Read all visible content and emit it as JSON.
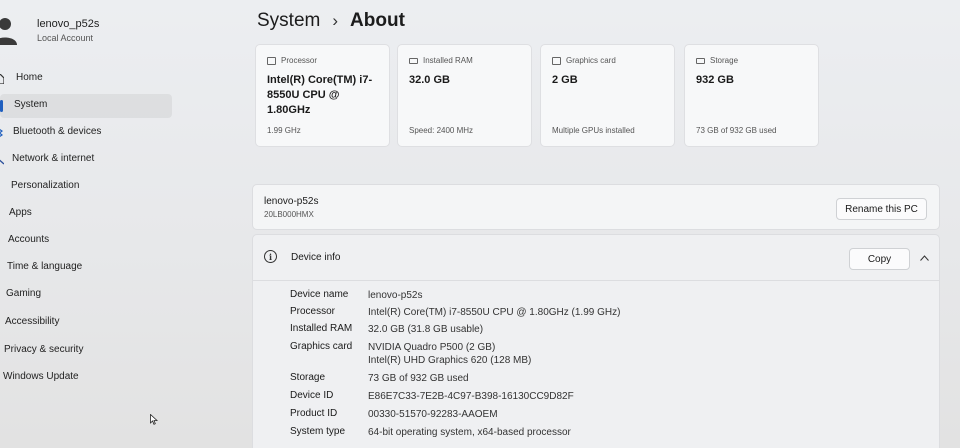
{
  "profile": {
    "name": "lenovo_p52s",
    "account_type": "Local Account"
  },
  "sidebar": {
    "items": [
      {
        "label": "Home"
      },
      {
        "label": "System",
        "active": true
      },
      {
        "label": "Bluetooth & devices"
      },
      {
        "label": "Network & internet"
      },
      {
        "label": "Personalization"
      },
      {
        "label": "Apps"
      },
      {
        "label": "Accounts"
      },
      {
        "label": "Time & language"
      },
      {
        "label": "Gaming"
      },
      {
        "label": "Accessibility"
      },
      {
        "label": "Privacy & security"
      },
      {
        "label": "Windows Update"
      }
    ]
  },
  "header": {
    "parent": "System",
    "separator": "›",
    "current": "About"
  },
  "cards": [
    {
      "title": "Processor",
      "value": "Intel(R) Core(TM) i7-8550U CPU @ 1.80GHz",
      "footer": "1.99 GHz",
      "icon": "processor-icon"
    },
    {
      "title": "Installed RAM",
      "value": "32.0 GB",
      "footer": "Speed: 2400 MHz",
      "icon": "ram-icon"
    },
    {
      "title": "Graphics card",
      "value": "2 GB",
      "footer": "Multiple GPUs installed",
      "icon": "graphics-card-icon"
    },
    {
      "title": "Storage",
      "value": "932 GB",
      "footer": "73 GB of 932 GB used",
      "icon": "storage-icon"
    }
  ],
  "pc": {
    "name": "lenovo-p52s",
    "model": "20LB000HMX",
    "rename_label": "Rename this PC"
  },
  "device_info": {
    "title": "Device info",
    "copy_label": "Copy",
    "rows": [
      {
        "label": "Device name",
        "value": "lenovo-p52s",
        "value2": ""
      },
      {
        "label": "Processor",
        "value": "Intel(R) Core(TM) i7-8550U CPU @ 1.80GHz (1.99 GHz)",
        "value2": ""
      },
      {
        "label": "Installed RAM",
        "value": "32.0 GB (31.8 GB usable)",
        "value2": ""
      },
      {
        "label": "Graphics card",
        "value": "NVIDIA Quadro P500 (2 GB)",
        "value2": "Intel(R) UHD Graphics 620 (128 MB)"
      },
      {
        "label": "Storage",
        "value": "73 GB of 932 GB used",
        "value2": ""
      },
      {
        "label": "Device ID",
        "value": "E86E7C33-7E2B-4C97-B398-16130CC9D82F",
        "value2": ""
      },
      {
        "label": "Product ID",
        "value": "00330-51570-92283-AAOEM",
        "value2": ""
      },
      {
        "label": "System type",
        "value": "64-bit operating system, x64-based processor",
        "value2": ""
      }
    ]
  },
  "colors": {
    "accent": "#1f5fbf",
    "card_bg": "#f7f8f9",
    "page_bg": "#eceef1"
  }
}
